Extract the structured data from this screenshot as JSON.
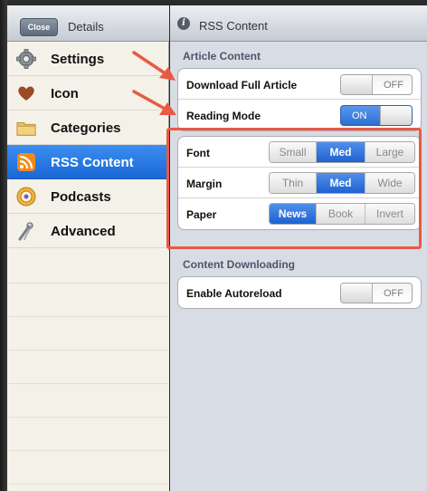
{
  "left": {
    "close_label": "Close",
    "title": "Details",
    "items": [
      {
        "label": "Settings",
        "icon": "gear-icon"
      },
      {
        "label": "Icon",
        "icon": "heart-icon"
      },
      {
        "label": "Categories",
        "icon": "folder-icon"
      },
      {
        "label": "RSS Content",
        "icon": "rss-icon",
        "selected": true
      },
      {
        "label": "Podcasts",
        "icon": "podcast-icon"
      },
      {
        "label": "Advanced",
        "icon": "tools-icon"
      }
    ]
  },
  "right": {
    "title": "RSS Content",
    "article_header": "Article Content",
    "download_label": "Download Full Article",
    "download_toggle": "OFF",
    "reading_label": "Reading Mode",
    "reading_toggle": "ON",
    "font_label": "Font",
    "font_options": [
      "Small",
      "Med",
      "Large"
    ],
    "font_selected": "Med",
    "margin_label": "Margin",
    "margin_options": [
      "Thin",
      "Med",
      "Wide"
    ],
    "margin_selected": "Med",
    "paper_label": "Paper",
    "paper_options": [
      "News",
      "Book",
      "Invert"
    ],
    "paper_selected": "News",
    "downloading_header": "Content Downloading",
    "autoreload_label": "Enable Autoreload",
    "autoreload_toggle": "OFF"
  },
  "colors": {
    "selected_blue": "#1a67d6",
    "annotation_red": "#e85a45"
  }
}
